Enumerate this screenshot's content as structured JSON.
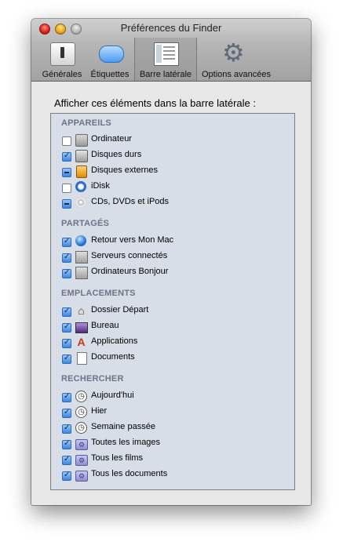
{
  "window": {
    "title": "Préférences du Finder"
  },
  "toolbar": {
    "items": [
      {
        "label": "Générales",
        "icon": "switch-icon"
      },
      {
        "label": "Étiquettes",
        "icon": "label-icon"
      },
      {
        "label": "Barre latérale",
        "icon": "sidebar-icon",
        "selected": true
      },
      {
        "label": "Options avancées",
        "icon": "gear-icon"
      }
    ]
  },
  "sidebar_prefs": {
    "heading": "Afficher ces éléments dans la barre latérale :",
    "sections": [
      {
        "title": "APPAREILS",
        "items": [
          {
            "label": "Ordinateur",
            "state": "unchecked",
            "icon": "computer-icon"
          },
          {
            "label": "Disques durs",
            "state": "checked",
            "icon": "hard-drive-icon"
          },
          {
            "label": "Disques externes",
            "state": "mixed",
            "icon": "external-drive-icon"
          },
          {
            "label": "iDisk",
            "state": "unchecked",
            "icon": "idisk-icon"
          },
          {
            "label": "CDs, DVDs et iPods",
            "state": "mixed",
            "icon": "cd-icon"
          }
        ]
      },
      {
        "title": "PARTAGÉS",
        "items": [
          {
            "label": "Retour vers Mon Mac",
            "state": "checked",
            "icon": "globe-icon"
          },
          {
            "label": "Serveurs connectés",
            "state": "checked",
            "icon": "server-icon"
          },
          {
            "label": "Ordinateurs Bonjour",
            "state": "checked",
            "icon": "server-icon"
          }
        ]
      },
      {
        "title": "EMPLACEMENTS",
        "items": [
          {
            "label": "Dossier Départ",
            "state": "checked",
            "icon": "home-icon"
          },
          {
            "label": "Bureau",
            "state": "checked",
            "icon": "desktop-icon"
          },
          {
            "label": "Applications",
            "state": "checked",
            "icon": "applications-icon"
          },
          {
            "label": "Documents",
            "state": "checked",
            "icon": "document-icon"
          }
        ]
      },
      {
        "title": "RECHERCHER",
        "items": [
          {
            "label": "Aujourd'hui",
            "state": "checked",
            "icon": "clock-icon"
          },
          {
            "label": "Hier",
            "state": "checked",
            "icon": "clock-icon"
          },
          {
            "label": "Semaine passée",
            "state": "checked",
            "icon": "clock-icon"
          },
          {
            "label": "Toutes les images",
            "state": "checked",
            "icon": "smart-folder-icon"
          },
          {
            "label": "Tous les films",
            "state": "checked",
            "icon": "smart-folder-icon"
          },
          {
            "label": "Tous les documents",
            "state": "checked",
            "icon": "smart-folder-icon"
          }
        ]
      }
    ]
  }
}
